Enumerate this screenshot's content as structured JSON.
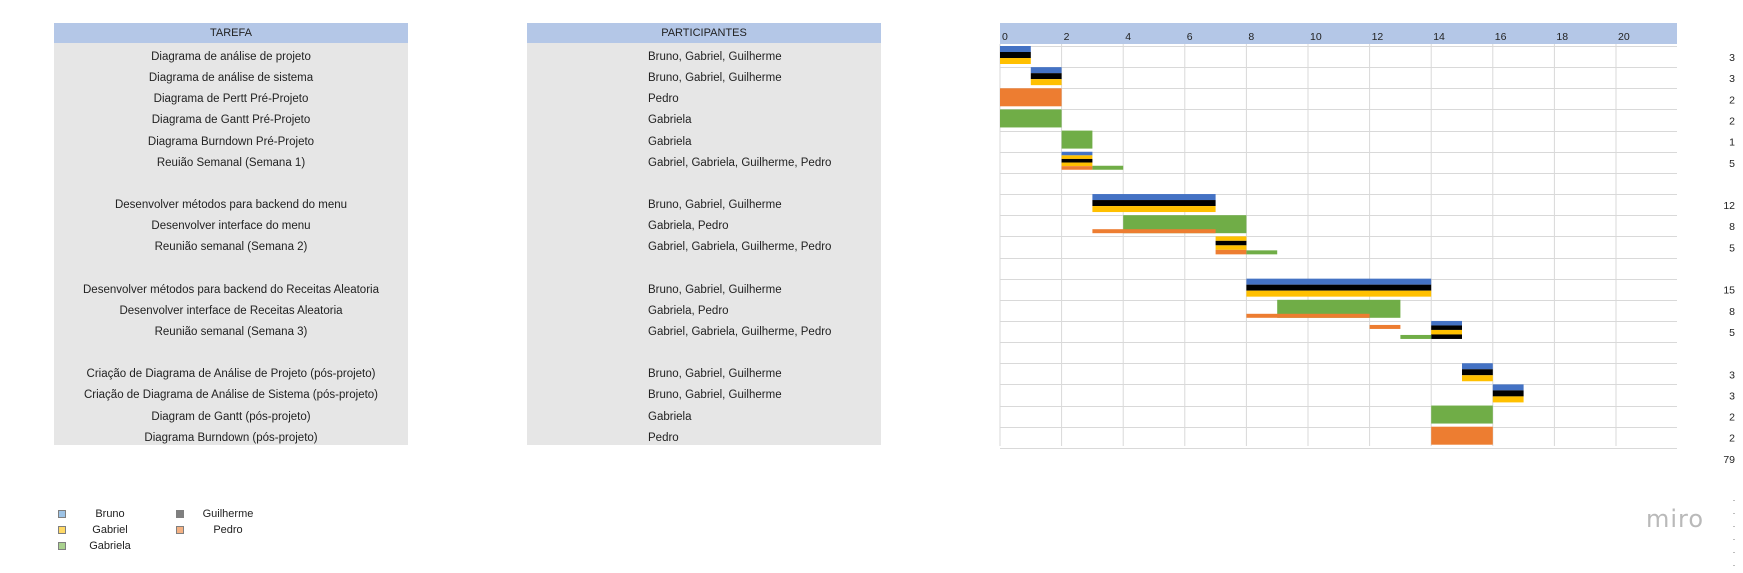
{
  "task_table": {
    "header": "TAREFA",
    "rows": [
      "Diagrama de análise de projeto",
      "Diagrama de análise de sistema",
      "Diagrama de Pertt Pré-Projeto",
      "Diagrama de Gantt Pré-Projeto",
      "Diagrama Burndown  Pré-Projeto",
      "Reuião Semanal (Semana 1)",
      "",
      "Desenvolver métodos para backend do menu",
      "Desenvolver interface do menu",
      "Reunião semanal (Semana 2)",
      "",
      "Desenvolver métodos para backend do Receitas Aleatoria",
      "Desenvolver interface de Receitas Aleatoria",
      "Reunião semanal (Semana 3)",
      "",
      "Criação de Diagrama de Análise de Projeto (pós-projeto)",
      "Criação de Diagrama de Análise de Sistema (pós-projeto)",
      "Diagram de Gantt  (pós-projeto)",
      "Diagrama Burndown  (pós-projeto)"
    ]
  },
  "participants_table": {
    "header": "PARTICIPANTES",
    "rows": [
      "Bruno, Gabriel, Guilherme",
      "Bruno, Gabriel, Guilherme",
      "Pedro",
      "Gabriela",
      "Gabriela",
      "Gabriel, Gabriela, Guilherme, Pedro",
      "",
      "Bruno, Gabriel, Guilherme",
      "Gabriela, Pedro",
      "Gabriel, Gabriela, Guilherme, Pedro",
      "",
      "Bruno, Gabriel, Guilherme",
      "Gabriela, Pedro",
      "Gabriel, Gabriela, Guilherme, Pedro",
      "",
      "Bruno, Gabriel, Guilherme",
      "Bruno, Gabriel, Guilherme",
      "Gabriela",
      "Pedro"
    ]
  },
  "chart_data": {
    "type": "bar",
    "orientation": "horizontal-gantt",
    "title": "",
    "xlabel": "",
    "ylabel": "",
    "xlim": [
      0,
      22
    ],
    "x_ticks": [
      "0",
      "2",
      "4",
      "6",
      "8",
      "10",
      "12",
      "14",
      "16",
      "18",
      "20"
    ],
    "grid": true,
    "member_colors": {
      "Bruno": "#4472c4",
      "Guilherme": "#000000",
      "Gabriel": "#ffc000",
      "Pedro": "#ed7d31",
      "Gabriela": "#70ad47"
    },
    "totals": [
      "3",
      "3",
      "2",
      "2",
      "1",
      "5",
      "",
      "12",
      "8",
      "5",
      "",
      "15",
      "8",
      "5",
      "",
      "3",
      "3",
      "2",
      "2"
    ],
    "grand_total": "79",
    "bars": [
      {
        "row": 0,
        "start": 0,
        "end": 1,
        "stack": [
          "Bruno",
          "Guilherme",
          "Gabriel"
        ]
      },
      {
        "row": 1,
        "start": 1,
        "end": 2,
        "stack": [
          "Bruno",
          "Guilherme",
          "Gabriel"
        ]
      },
      {
        "row": 2,
        "start": 0,
        "end": 2,
        "stack": [
          "Pedro"
        ]
      },
      {
        "row": 3,
        "start": 0,
        "end": 2,
        "stack": [
          "Gabriela"
        ]
      },
      {
        "row": 4,
        "start": 2,
        "end": 3,
        "stack": [
          "Gabriela"
        ]
      },
      {
        "row": 5,
        "start": 2,
        "end": 3,
        "stack": [
          "Bruno",
          "Gabriel",
          "Guilherme",
          "Gabriel",
          "Pedro"
        ]
      },
      {
        "row": 5,
        "start": 3,
        "end": 4,
        "stack": [
          "Gabriela"
        ],
        "offset": "low"
      },
      {
        "row": 7,
        "start": 3,
        "end": 7,
        "stack": [
          "Bruno",
          "Guilherme",
          "Gabriel"
        ]
      },
      {
        "row": 8,
        "start": 4,
        "end": 8,
        "stack": [
          "Gabriela"
        ]
      },
      {
        "row": 8,
        "start": 3,
        "end": 7,
        "stack": [
          "Pedro"
        ],
        "offset": "low"
      },
      {
        "row": 9,
        "start": 7,
        "end": 8,
        "stack": [
          "Gabriel",
          "Guilherme",
          "Gabriel",
          "Pedro"
        ]
      },
      {
        "row": 9,
        "start": 8,
        "end": 9,
        "stack": [
          "Gabriela"
        ],
        "offset": "low"
      },
      {
        "row": 11,
        "start": 8,
        "end": 14,
        "stack": [
          "Bruno",
          "Guilherme",
          "Gabriel"
        ]
      },
      {
        "row": 12,
        "start": 9,
        "end": 13,
        "stack": [
          "Gabriela"
        ]
      },
      {
        "row": 12,
        "start": 8,
        "end": 12,
        "stack": [
          "Pedro"
        ],
        "offset": "low"
      },
      {
        "row": 13,
        "start": 14,
        "end": 15,
        "stack": [
          "Bruno",
          "Guilherme",
          "Gabriel",
          "Guilherme"
        ]
      },
      {
        "row": 13,
        "start": 12,
        "end": 13,
        "stack": [
          "Pedro"
        ],
        "offset": "thin-high"
      },
      {
        "row": 13,
        "start": 13,
        "end": 14,
        "stack": [
          "Gabriela"
        ],
        "offset": "low"
      },
      {
        "row": 15,
        "start": 15,
        "end": 16,
        "stack": [
          "Bruno",
          "Guilherme",
          "Gabriel"
        ]
      },
      {
        "row": 16,
        "start": 16,
        "end": 17,
        "stack": [
          "Bruno",
          "Guilherme",
          "Gabriel"
        ]
      },
      {
        "row": 17,
        "start": 14,
        "end": 16,
        "stack": [
          "Gabriela"
        ]
      },
      {
        "row": 18,
        "start": 14,
        "end": 16,
        "stack": [
          "Pedro"
        ]
      }
    ]
  },
  "legend": [
    {
      "name": "Bruno",
      "color": "#9dc3e6"
    },
    {
      "name": "Guilherme",
      "color": "#7f7f7f"
    },
    {
      "name": "Gabriel",
      "color": "#ffd966"
    },
    {
      "name": "Pedro",
      "color": "#f4b183"
    },
    {
      "name": "Gabriela",
      "color": "#a9d18e"
    }
  ],
  "branding": {
    "logo": "miro"
  }
}
